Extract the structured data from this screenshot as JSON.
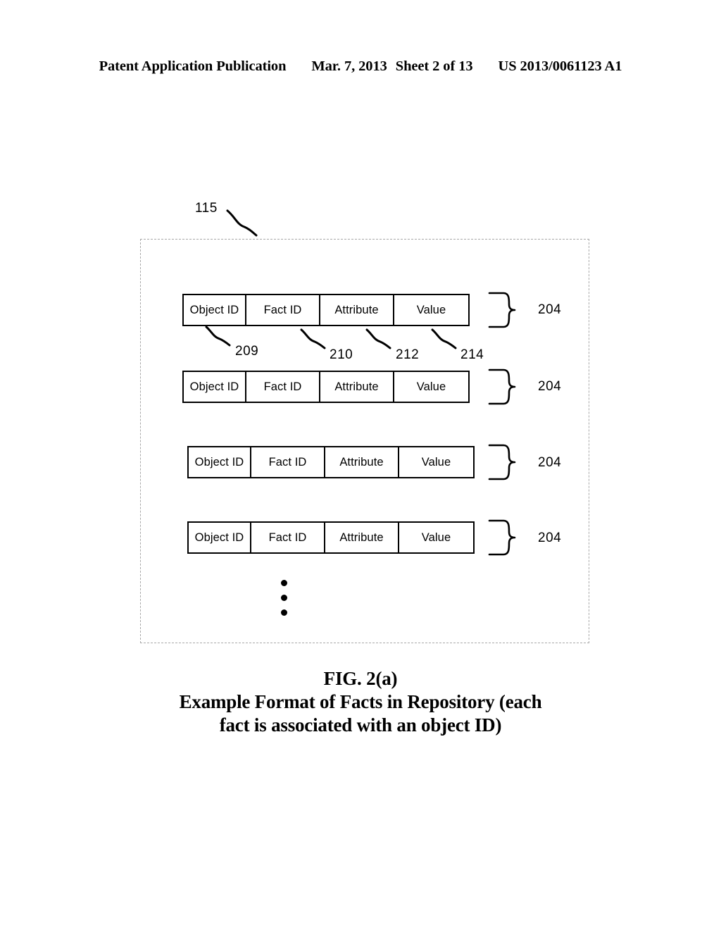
{
  "header": {
    "publication": "Patent Application Publication",
    "date": "Mar. 7, 2013",
    "sheet": "Sheet 2 of 13",
    "pub_number": "US 2013/0061123 A1"
  },
  "figure": {
    "repository_ref": "115",
    "columns": [
      "Object ID",
      "Fact ID",
      "Attribute",
      "Value"
    ],
    "rows": [
      {
        "cells": [
          "Object ID",
          "Fact ID",
          "Attribute",
          "Value"
        ],
        "brace_ref": "204"
      },
      {
        "cells": [
          "Object ID",
          "Fact ID",
          "Attribute",
          "Value"
        ],
        "brace_ref": "204"
      },
      {
        "cells": [
          "Object ID",
          "Fact ID",
          "Attribute",
          "Value"
        ],
        "brace_ref": "204"
      },
      {
        "cells": [
          "Object ID",
          "Fact ID",
          "Attribute",
          "Value"
        ],
        "brace_ref": "204"
      }
    ],
    "field_refs": [
      {
        "label": "209",
        "field": "Object ID"
      },
      {
        "label": "210",
        "field": "Fact ID"
      },
      {
        "label": "212",
        "field": "Attribute"
      },
      {
        "label": "214",
        "field": "Value"
      }
    ],
    "continuation": "vertical-ellipsis"
  },
  "caption": {
    "fig_number": "FIG. 2(a)",
    "title_line_1": "Example Format of Facts in Repository (each",
    "title_line_2": "fact is associated with an object ID)"
  }
}
